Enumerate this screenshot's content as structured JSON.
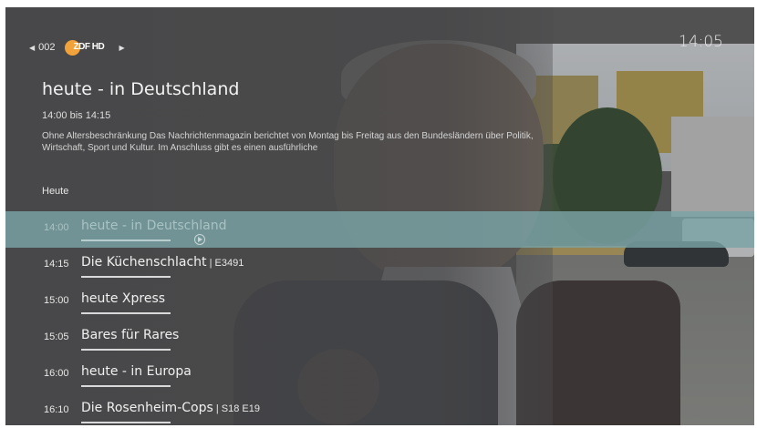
{
  "channel": {
    "number": "002",
    "logo_text": "ZDF HD",
    "prev_icon": "chevron-left-icon",
    "next_icon": "chevron-right-icon"
  },
  "clock": "14:05",
  "program": {
    "title": "heute - in Deutschland",
    "time": "14:00 bis 14:15",
    "description": "Ohne Altersbeschränkung Das Nachrichtenmagazin berichtet von Montag bis Freitag aus den Bundesländern über Politik, Wirtschaft, Sport und Kultur. Im Anschluss gibt es einen ausführliche"
  },
  "day_label": "Heute",
  "schedule": [
    {
      "time": "14:00",
      "title": "heute - in Deutschland",
      "episode": "",
      "active": true
    },
    {
      "time": "14:15",
      "title": "Die Küchenschlacht",
      "episode": "E3491",
      "active": false
    },
    {
      "time": "15:00",
      "title": "heute Xpress",
      "episode": "",
      "active": false
    },
    {
      "time": "15:05",
      "title": "Bares für Rares",
      "episode": "",
      "active": false
    },
    {
      "time": "16:00",
      "title": "heute - in Europa",
      "episode": "",
      "active": false
    },
    {
      "time": "16:10",
      "title": "Die Rosenheim-Cops",
      "episode": "S18 E19",
      "active": false
    }
  ],
  "colors": {
    "highlight": "#7aa4a6",
    "logo_accent": "#f2a23a"
  }
}
